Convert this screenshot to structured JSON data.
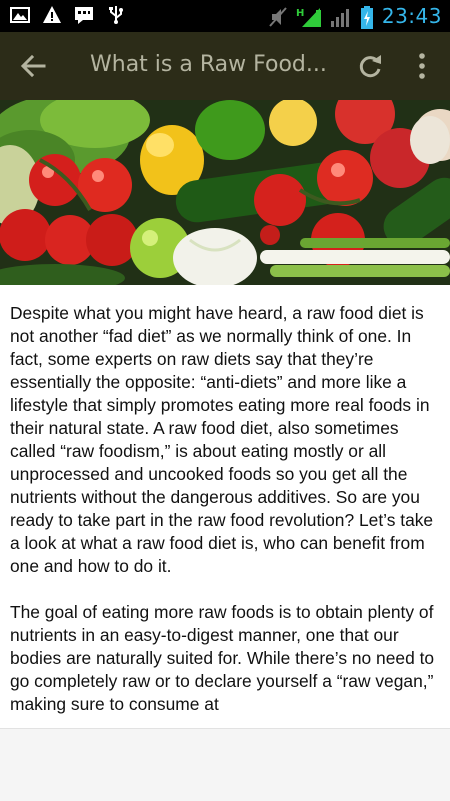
{
  "status_bar": {
    "time": "23:43",
    "icons": [
      "image-icon",
      "warning-icon",
      "message-icon",
      "usb-icon",
      "mute-icon",
      "signal-h-icon",
      "signal-icon",
      "battery-icon"
    ],
    "clock_color": "#35b6ea"
  },
  "app_bar": {
    "title": "What is a Raw Food...",
    "background": "#2c2c18",
    "back_icon": "arrow-left-icon",
    "refresh_icon": "refresh-icon",
    "more_icon": "more-vert-icon"
  },
  "hero": {
    "subject": "vegetables-and-fruits"
  },
  "article": {
    "paragraphs": [
      "Despite what you might have heard, a raw food diet is not another “fad diet” as we normally think of one. In fact, some experts on raw diets say that they’re essentially the opposite: “anti-diets” and more like a lifestyle that simply promotes eating more real foods in their natural state. A raw food diet, also sometimes called “raw foodism,” is about eating mostly or all unprocessed and uncooked foods so you get all the nutrients without the dangerous additives. So are you ready to take part in the raw food revolution? Let’s take a look at what a raw food diet is, who can benefit from one and how to do it.",
      "The goal of eating more raw foods is to obtain plenty of nutrients in an easy-to-digest manner, one that our bodies are naturally suited for. While there’s no need to go completely raw or to declare yourself a “raw vegan,” making sure to consume at"
    ]
  }
}
